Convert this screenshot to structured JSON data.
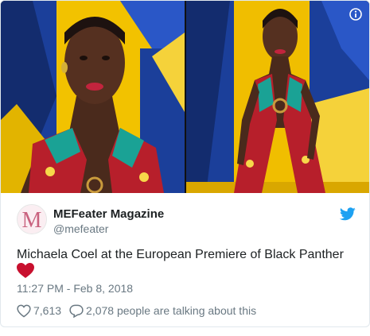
{
  "tweet": {
    "author": {
      "name": "MEFeater Magazine",
      "handle": "@mefeater",
      "avatar_letter": "M"
    },
    "text": "Michaela Coel at the European Premiere of Black Panther",
    "emoji": "red-heart",
    "timestamp": "11:27 PM - Feb 8, 2018",
    "likes": "7,613",
    "conversation": "2,078 people are talking about this"
  },
  "colors": {
    "twitter_blue": "#1da1f2",
    "heart_red": "#c8102e",
    "avatar_pink": "#c9627f",
    "muted_text": "#697882",
    "body_text": "#1c2022"
  },
  "icons": [
    "info-icon",
    "twitter-bird-icon",
    "heart-outline-icon",
    "reply-bubble-icon"
  ]
}
